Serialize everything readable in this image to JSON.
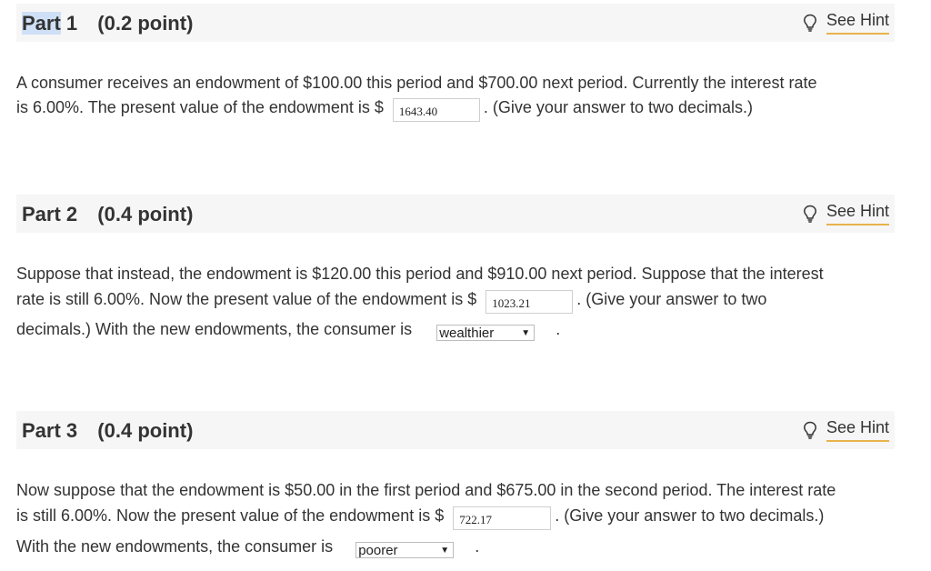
{
  "parts": [
    {
      "part_word": "Part",
      "part_num": "1",
      "points": "(0.2 point)",
      "hint_label": "See Hint",
      "line1": "A consumer receives an endowment of $100.00 this period and $700.00 next period. Currently the interest rate",
      "line2_pre": "is 6.00%. The present value of the endowment is $",
      "answer": "1643.40",
      "line2_post": ". (Give your answer to two decimals.)"
    },
    {
      "part_word": "Part",
      "part_num": "2",
      "points": "(0.4 point)",
      "hint_label": "See Hint",
      "line1": "Suppose that instead, the endowment is $120.00 this period and $910.00 next period. Suppose that the interest",
      "line2_pre": "rate is still 6.00%. Now the present value of the endowment is $",
      "answer": "1023.21",
      "line2_post": ". (Give your answer to two",
      "line3_pre": "decimals.) With the new endowments, the consumer is",
      "select_value": "wealthier",
      "line3_post": "."
    },
    {
      "part_word": "Part",
      "part_num": "3",
      "points": "(0.4 point)",
      "hint_label": "See Hint",
      "line1": "Now suppose that the endowment is $50.00 in the first period and $675.00 in the second period. The interest rate",
      "line2_pre": "is still 6.00%. Now the present value of the endowment is $",
      "answer": "722.17",
      "line2_post": ".  (Give your answer to two decimals.)",
      "line3_pre": "With the new endowments, the consumer is",
      "select_value": "poorer",
      "line3_post": "."
    }
  ],
  "icons": {
    "hint": "lightbulb-icon",
    "dropdown": "chevron-down-icon"
  },
  "colors": {
    "header_bg": "#f6f6f6",
    "hint_underline": "#e8b34b",
    "selection_highlight": "#cfe0f6"
  }
}
